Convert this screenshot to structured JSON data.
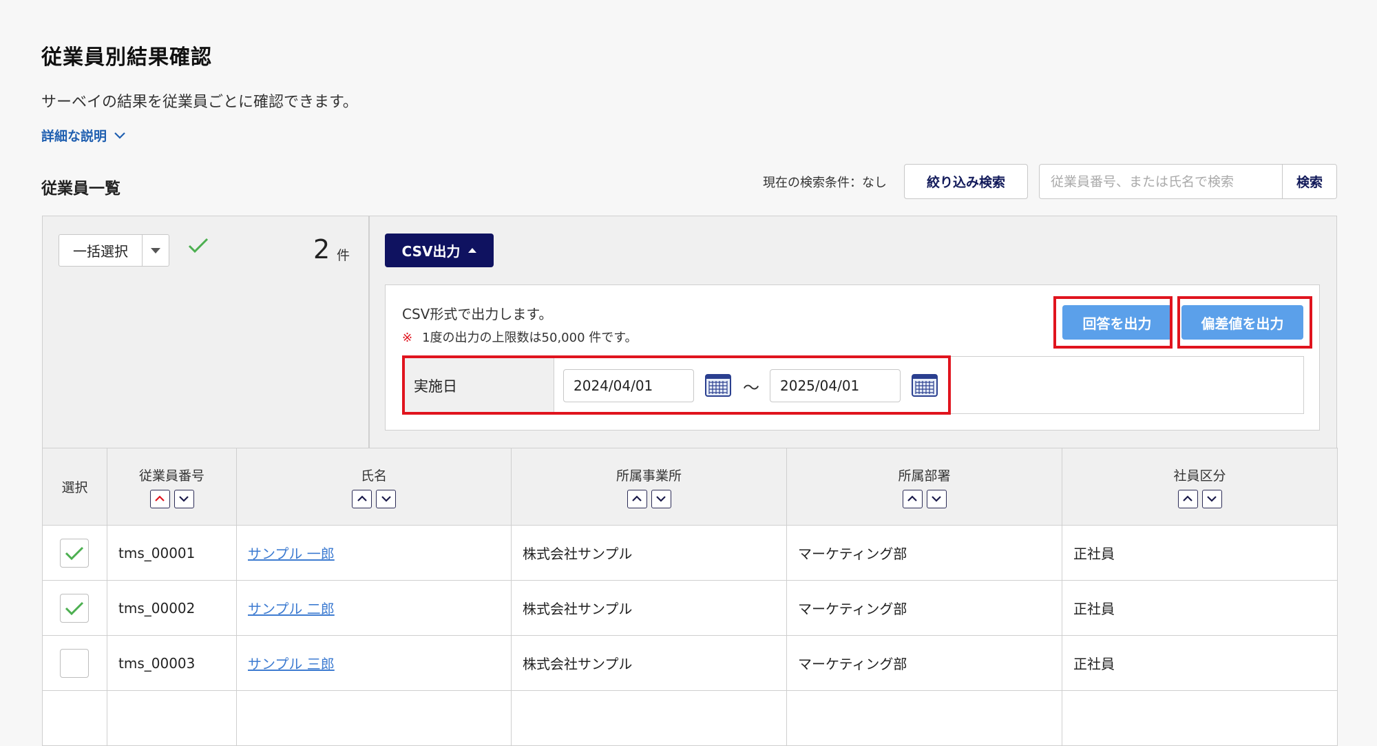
{
  "page": {
    "title": "従業員別結果確認",
    "description": "サーベイの結果を従業員ごとに確認できます。",
    "detail_link": "詳細な説明"
  },
  "list": {
    "title": "従業員一覧",
    "current_condition": "現在の検索条件：なし",
    "filter_button": "絞り込み検索",
    "search_placeholder": "従業員番号、または氏名で検索",
    "search_button": "検索"
  },
  "toolbar": {
    "bulk_select": "一括選択",
    "count": "2",
    "count_unit": "件",
    "csv_button": "CSV出力"
  },
  "csv": {
    "description": "CSV形式で出力します。",
    "note_mark": "※",
    "note": "1度の出力の上限数は50,000 件です。",
    "output_answers": "回答を出力",
    "output_deviation": "偏差値を出力",
    "date_label": "実施日",
    "date_from": "2024/04/01",
    "date_to": "2025/04/01",
    "range_separator": "～"
  },
  "table": {
    "headers": [
      "選択",
      "従業員番号",
      "氏名",
      "所属事業所",
      "所属部署",
      "社員区分"
    ],
    "rows": [
      {
        "checked": true,
        "id": "tms_00001",
        "name": "サンプル 一郎",
        "office": "株式会社サンプル",
        "dept": "マーケティング部",
        "type": "正社員"
      },
      {
        "checked": true,
        "id": "tms_00002",
        "name": "サンプル 二郎",
        "office": "株式会社サンプル",
        "dept": "マーケティング部",
        "type": "正社員"
      },
      {
        "checked": false,
        "id": "tms_00003",
        "name": "サンプル 三郎",
        "office": "株式会社サンプル",
        "dept": "マーケティング部",
        "type": "正社員"
      }
    ]
  },
  "colors": {
    "navy": "#0f1260",
    "blue_button": "#5ba0ea",
    "highlight_red": "#e0141e",
    "link": "#3d7bd1",
    "check_green": "#4caf50",
    "active_sort": "#e0141e"
  }
}
